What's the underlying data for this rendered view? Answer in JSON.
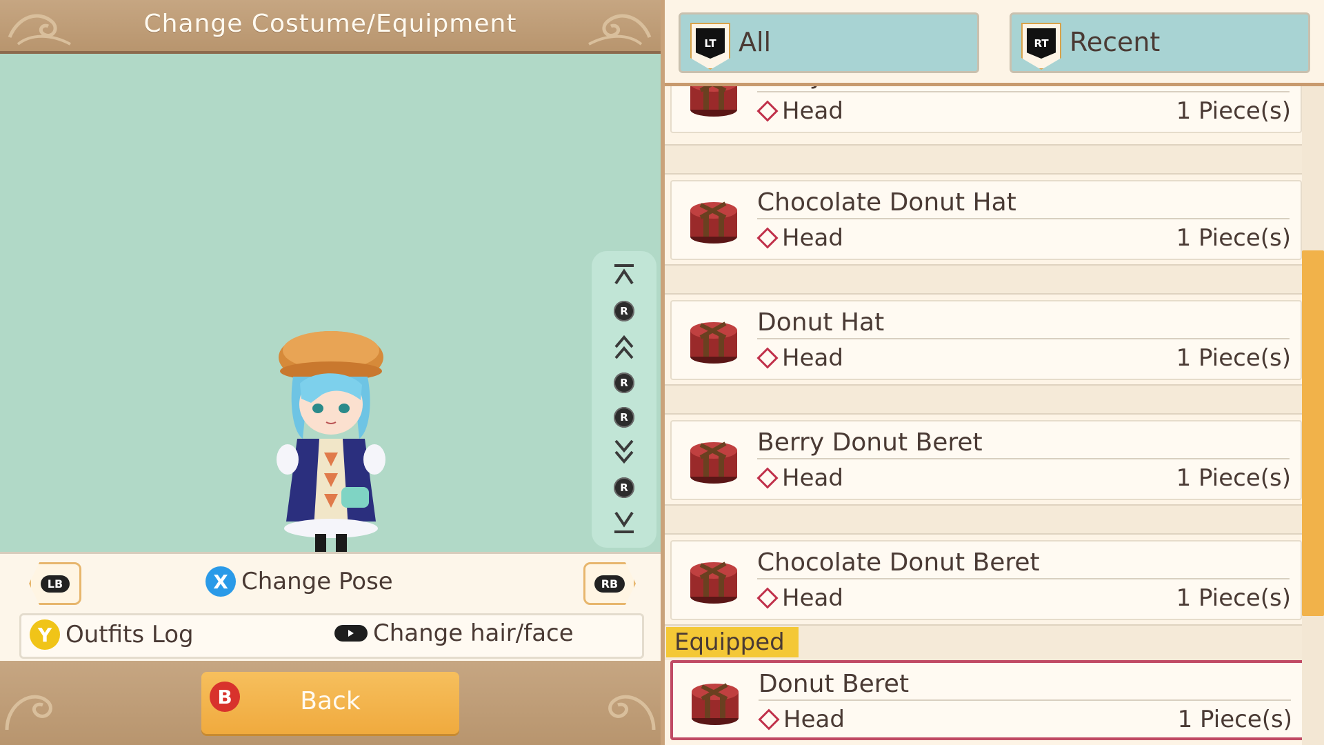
{
  "left_panel": {
    "title": "Change Costume/Equipment",
    "controls": {
      "lb_label": "LB",
      "rb_label": "RB",
      "x_label": "X",
      "change_pose": "Change Pose",
      "y_label": "Y",
      "outfits_log": "Outfits Log",
      "change_hair_face": "Change hair/face",
      "r_label": "R"
    },
    "back": {
      "b_label": "B",
      "label": "Back"
    }
  },
  "tabs": [
    {
      "trigger": "LT",
      "label": "All"
    },
    {
      "trigger": "RT",
      "label": "Recent"
    }
  ],
  "items": [
    {
      "name": "Berry Donut Hat",
      "category": "Head",
      "quantity": "1 Piece(s)"
    },
    {
      "name": "Chocolate Donut Hat",
      "category": "Head",
      "quantity": "1 Piece(s)"
    },
    {
      "name": "Donut Hat",
      "category": "Head",
      "quantity": "1 Piece(s)"
    },
    {
      "name": "Berry Donut Beret",
      "category": "Head",
      "quantity": "1 Piece(s)"
    },
    {
      "name": "Chocolate Donut Beret",
      "category": "Head",
      "quantity": "1 Piece(s)"
    }
  ],
  "equipped": {
    "label": "Equipped",
    "item": {
      "name": "Donut Beret",
      "category": "Head",
      "quantity": "1 Piece(s)"
    }
  },
  "colors": {
    "accent_orange": "#f1b24a",
    "equipped_yellow": "#f4c836",
    "equipped_border": "#c04a64",
    "tab_blue": "#a8d3d3",
    "viewport_green": "#b1d9c7"
  }
}
